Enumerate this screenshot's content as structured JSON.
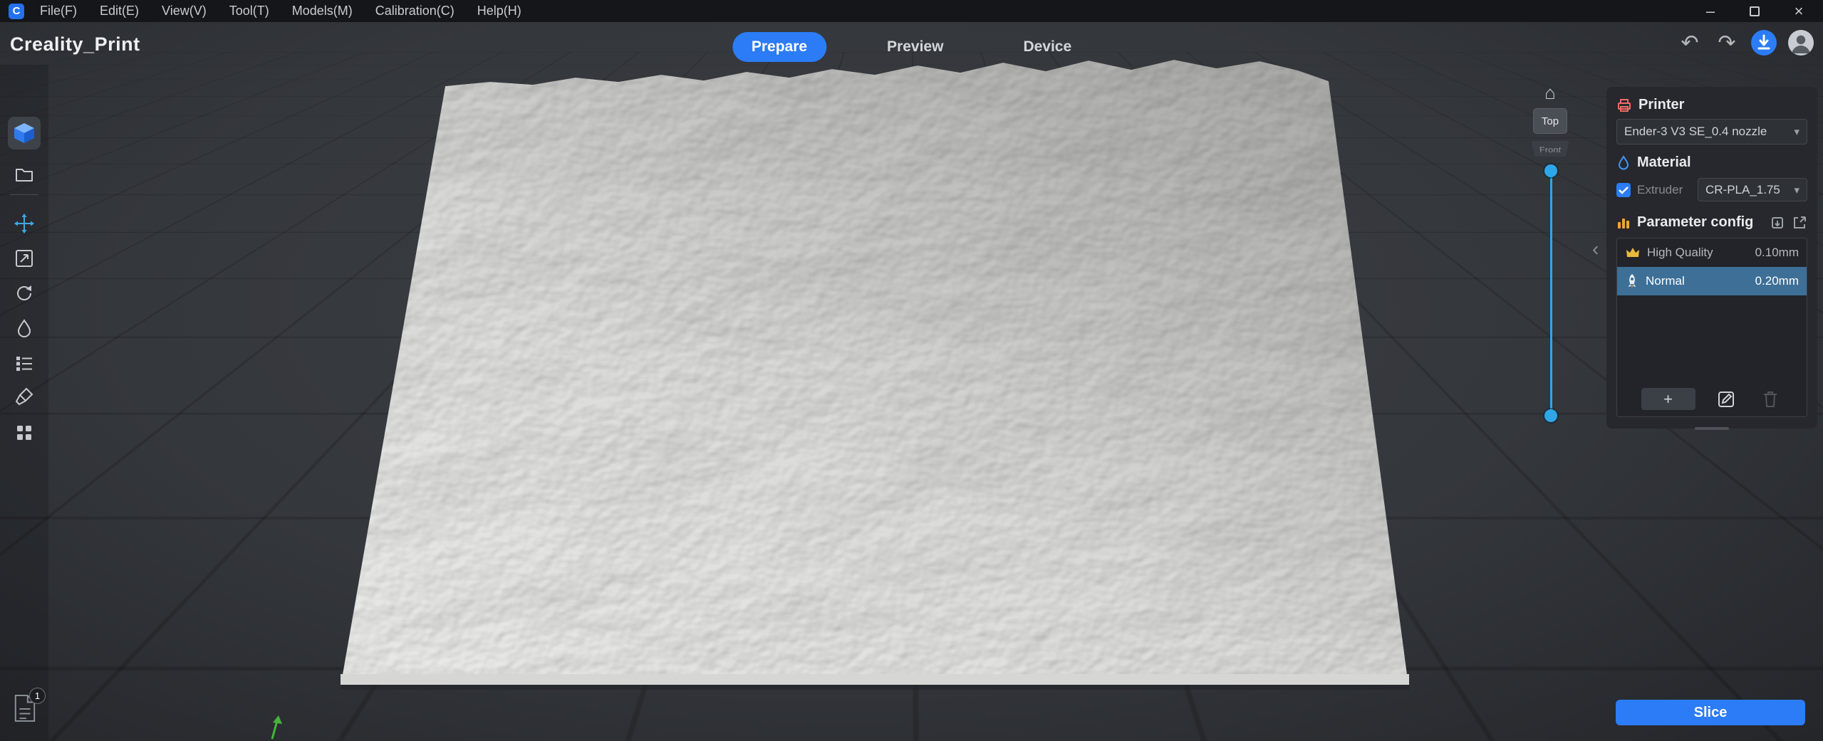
{
  "app": {
    "logo_letter": "C",
    "title": "Creality_Print"
  },
  "menubar": {
    "items": [
      "File(F)",
      "Edit(E)",
      "View(V)",
      "Tool(T)",
      "Models(M)",
      "Calibration(C)",
      "Help(H)"
    ]
  },
  "icons": {
    "undo": "↶",
    "redo": "↷",
    "home": "⌂",
    "chevron_down": "▾",
    "collapse": "‹",
    "minimize": "–",
    "close": "×"
  },
  "tabs": [
    {
      "label": "Prepare"
    },
    {
      "label": "Preview"
    },
    {
      "label": "Device"
    }
  ],
  "viewport": {
    "viewcube": {
      "top": "Top",
      "front": "Front"
    }
  },
  "right_panel": {
    "printer": {
      "title": "Printer",
      "selected_printer": "Ender-3 V3 SE_0.4 nozzle"
    },
    "material": {
      "title": "Material",
      "extruder_label": "Extruder",
      "extruder_checked": true,
      "selected_material": "CR-PLA_1.75"
    },
    "parameter": {
      "title": "Parameter config",
      "profiles": [
        {
          "name": "High Quality",
          "layer_height": "0.10mm",
          "selected": false
        },
        {
          "name": "Normal",
          "layer_height": "0.20mm",
          "selected": true
        }
      ],
      "add_button": "+"
    }
  },
  "slice": {
    "label": "Slice"
  },
  "statusbar": {
    "badge_count": "1"
  },
  "colors": {
    "accent": "#2b7cf6",
    "selected_row": "#3d6f97",
    "slider": "#2fa6e8",
    "panel": "#26282d",
    "viewport": "#34373c"
  }
}
